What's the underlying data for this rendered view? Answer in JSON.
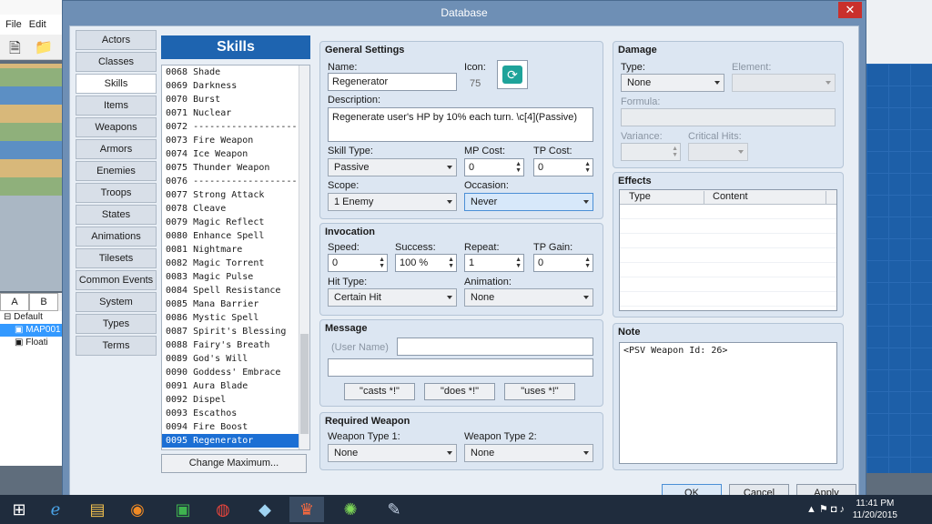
{
  "background_app": {
    "menu": [
      "File",
      "Edit"
    ],
    "tabs": [
      "A",
      "B"
    ],
    "tree": [
      {
        "label": "Default",
        "selected": false
      },
      {
        "label": "MAP001",
        "selected": true
      },
      {
        "label": "Floati",
        "selected": false
      }
    ]
  },
  "dialog": {
    "title": "Database",
    "close_glyph": "✕"
  },
  "categories": [
    {
      "label": "Actors",
      "active": false
    },
    {
      "label": "Classes",
      "active": false
    },
    {
      "label": "Skills",
      "active": true
    },
    {
      "label": "Items",
      "active": false
    },
    {
      "label": "Weapons",
      "active": false
    },
    {
      "label": "Armors",
      "active": false
    },
    {
      "label": "Enemies",
      "active": false
    },
    {
      "label": "Troops",
      "active": false
    },
    {
      "label": "States",
      "active": false
    },
    {
      "label": "Animations",
      "active": false
    },
    {
      "label": "Tilesets",
      "active": false
    },
    {
      "label": "Common Events",
      "active": false
    },
    {
      "label": "System",
      "active": false
    },
    {
      "label": "Types",
      "active": false
    },
    {
      "label": "Terms",
      "active": false
    }
  ],
  "skills": {
    "header": "Skills",
    "change_max_label": "Change Maximum...",
    "items": [
      "0068 Shade",
      "0069 Darkness",
      "0070 Burst",
      "0071 Nuclear",
      "0072 -------------------",
      "0073 Fire Weapon",
      "0074 Ice Weapon",
      "0075 Thunder Weapon",
      "0076 -------------------",
      "0077 Strong Attack",
      "0078 Cleave",
      "0079 Magic Reflect",
      "0080 Enhance Spell",
      "0081 Nightmare",
      "0082 Magic Torrent",
      "0083 Magic Pulse",
      "0084 Spell Resistance",
      "0085 Mana Barrier",
      "0086 Mystic Spell",
      "0087 Spirit's Blessing",
      "0088 Fairy's Breath",
      "0089 God's Will",
      "0090 Goddess' Embrace",
      "0091 Aura Blade",
      "0092 Dispel",
      "0093 Escathos",
      "0094 Fire Boost",
      "0095 Regenerator"
    ],
    "selected_index": 27
  },
  "general": {
    "title": "General Settings",
    "name_label": "Name:",
    "name_value": "Regenerator",
    "icon_label": "Icon:",
    "icon_index": "75",
    "description_label": "Description:",
    "description_value": "Regenerate user's HP by 10% each turn. \\c[4](Passive)",
    "skill_type_label": "Skill Type:",
    "skill_type_value": "Passive",
    "mp_cost_label": "MP Cost:",
    "mp_cost_value": "0",
    "tp_cost_label": "TP Cost:",
    "tp_cost_value": "0",
    "scope_label": "Scope:",
    "scope_value": "1 Enemy",
    "occasion_label": "Occasion:",
    "occasion_value": "Never"
  },
  "invocation": {
    "title": "Invocation",
    "speed_label": "Speed:",
    "speed_value": "0",
    "success_label": "Success:",
    "success_value": "100 %",
    "repeat_label": "Repeat:",
    "repeat_value": "1",
    "tp_gain_label": "TP Gain:",
    "tp_gain_value": "0",
    "hit_type_label": "Hit Type:",
    "hit_type_value": "Certain Hit",
    "animation_label": "Animation:",
    "animation_value": "None"
  },
  "message": {
    "title": "Message",
    "user_name_label": "(User Name)",
    "line1": "",
    "line2": "",
    "casts_btn": "\"casts *!\"",
    "does_btn": "\"does *!\"",
    "uses_btn": "\"uses *!\""
  },
  "required_weapon": {
    "title": "Required Weapon",
    "type1_label": "Weapon Type 1:",
    "type1_value": "None",
    "type2_label": "Weapon Type 2:",
    "type2_value": "None"
  },
  "damage": {
    "title": "Damage",
    "type_label": "Type:",
    "type_value": "None",
    "element_label": "Element:",
    "element_value": "",
    "formula_label": "Formula:",
    "formula_value": "",
    "variance_label": "Variance:",
    "variance_value": "",
    "critical_label": "Critical Hits:",
    "critical_value": ""
  },
  "effects": {
    "title": "Effects",
    "col_type": "Type",
    "col_content": "Content"
  },
  "note": {
    "title": "Note",
    "value": "<PSV Weapon Id: 26>"
  },
  "buttons": {
    "ok": "OK",
    "cancel": "Cancel",
    "apply": "Apply"
  },
  "taskbar": {
    "time": "11:41 PM",
    "date": "11/20/2015",
    "tray_glyphs": "▲ ⚑ ◘ ♪"
  },
  "colors": {
    "dialog_frame": "#6e8fb5",
    "skills_header": "#1e64b0",
    "selection": "#1c6fd4",
    "close_button": "#c9302c"
  }
}
